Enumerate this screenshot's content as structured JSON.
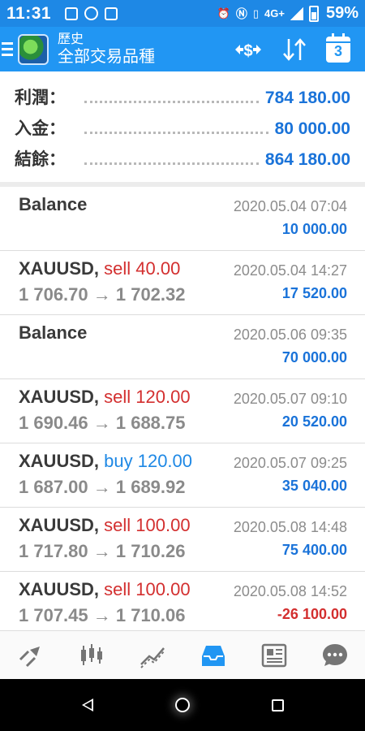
{
  "status_bar": {
    "time": "11:31",
    "network": "4G+",
    "battery": "59%"
  },
  "app_bar": {
    "title": "歷史",
    "subtitle": "全部交易品種",
    "calendar_day": "3"
  },
  "summary": {
    "profit_label": "利潤：",
    "profit_value": "784 180.00",
    "deposit_label": "入金：",
    "deposit_value": "80 000.00",
    "balance_label": "結餘：",
    "balance_value": "864 180.00"
  },
  "rows": [
    {
      "kind": "balance",
      "title": "Balance",
      "date": "2020.05.04 07:04",
      "amount": "10 000.00"
    },
    {
      "kind": "trade",
      "symbol": "XAUUSD,",
      "side": "sell 40.00",
      "prices": "1 706.70 → 1 702.32",
      "date": "2020.05.04 14:27",
      "amount": "17 520.00"
    },
    {
      "kind": "balance",
      "title": "Balance",
      "date": "2020.05.06 09:35",
      "amount": "70 000.00"
    },
    {
      "kind": "trade",
      "symbol": "XAUUSD,",
      "side": "sell 120.00",
      "prices": "1 690.46 → 1 688.75",
      "date": "2020.05.07 09:10",
      "amount": "20 520.00"
    },
    {
      "kind": "trade",
      "symbol": "XAUUSD,",
      "side": "buy 120.00",
      "prices": "1 687.00 → 1 689.92",
      "date": "2020.05.07 09:25",
      "amount": "35 040.00"
    },
    {
      "kind": "trade",
      "symbol": "XAUUSD,",
      "side": "sell 100.00",
      "prices": "1 717.80 → 1 710.26",
      "date": "2020.05.08 14:48",
      "amount": "75 400.00"
    },
    {
      "kind": "trade",
      "symbol": "XAUUSD,",
      "side": "sell 100.00",
      "prices": "1 707.45 → 1 710.06",
      "date": "2020.05.08 14:52",
      "amount": "-26 100.00"
    }
  ],
  "bottom_nav": {
    "items": [
      {
        "icon": "quotes-arrows-icon"
      },
      {
        "icon": "candlestick-chart-icon"
      },
      {
        "icon": "trend-line-icon"
      },
      {
        "icon": "history-inbox-icon",
        "active": true
      },
      {
        "icon": "news-icon"
      },
      {
        "icon": "chat-icon"
      }
    ]
  },
  "colors": {
    "app_bar": "#2196f3",
    "status_bar": "#1e88e5",
    "positive": "#1a73d9",
    "negative": "#d32f2f",
    "nav_active": "#2196f3",
    "nav_inactive": "#757575"
  }
}
